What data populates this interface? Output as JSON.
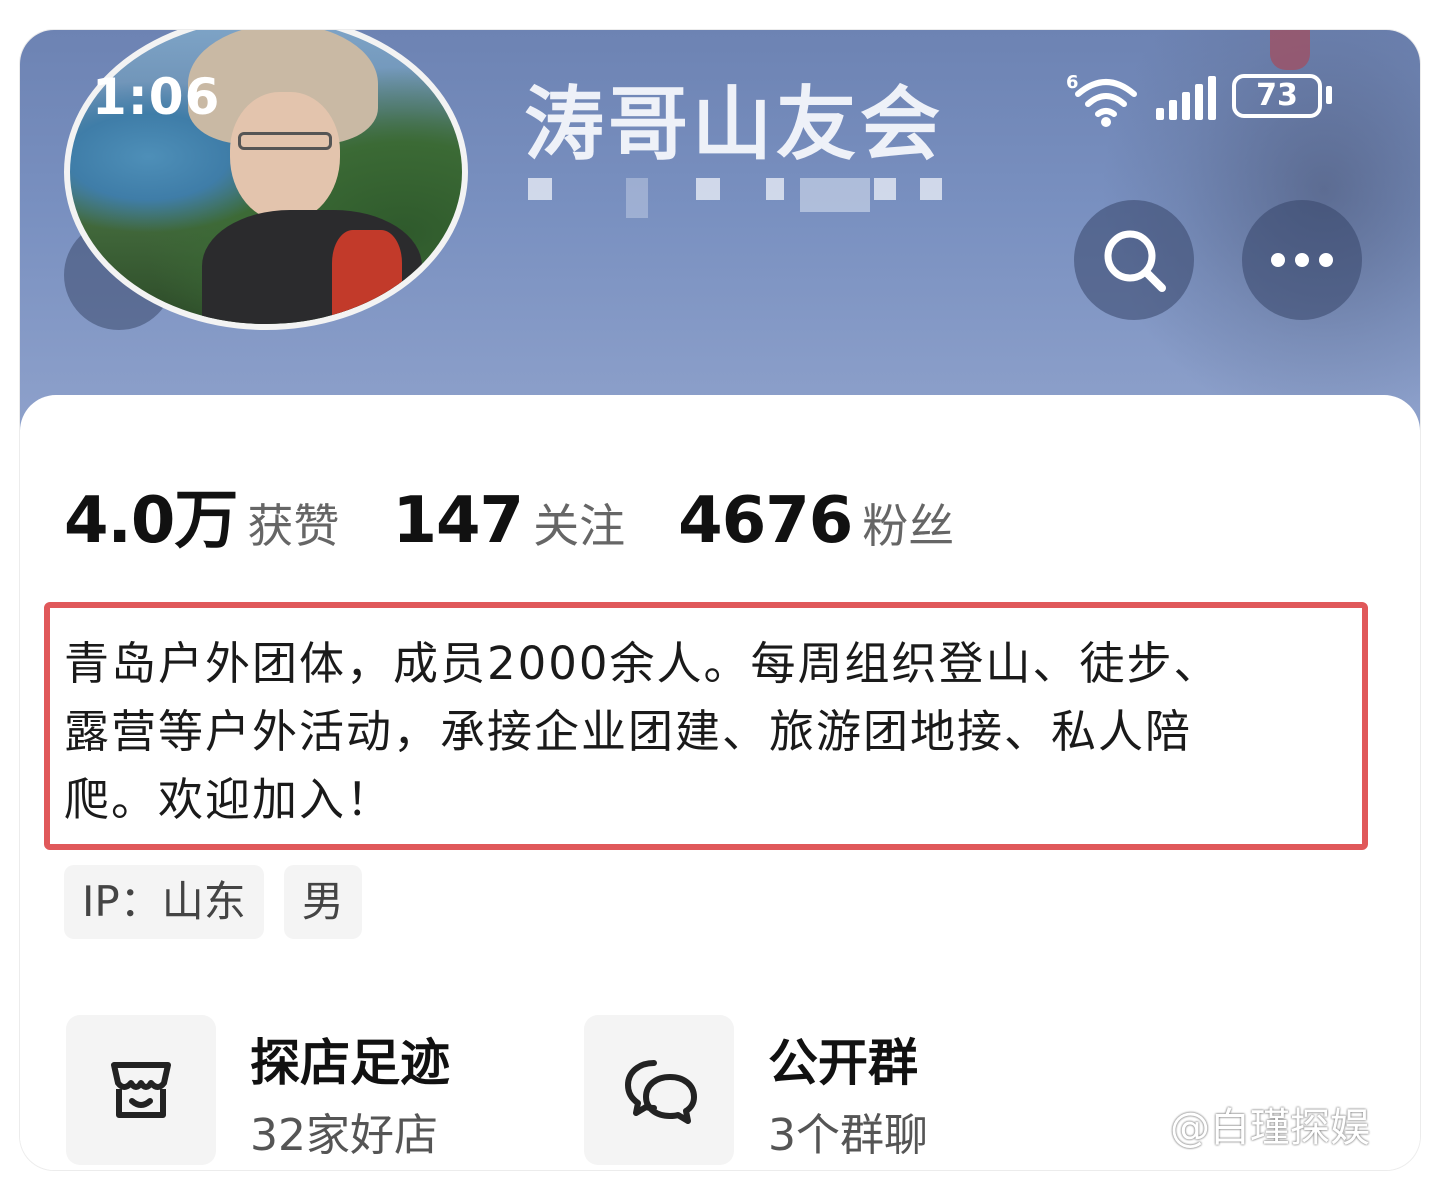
{
  "status_bar": {
    "time": "1:06",
    "network_badge": "6",
    "battery_level": "73"
  },
  "header": {
    "account_name": "涛哥山友会",
    "search_icon": "search-icon",
    "more_icon": "more-dots-icon",
    "back_icon": "chevron-left-icon"
  },
  "stats": [
    {
      "value": "4.0万",
      "label": "获赞"
    },
    {
      "value": "147",
      "label": "关注"
    },
    {
      "value": "4676",
      "label": "粉丝"
    }
  ],
  "bio": {
    "lines": [
      "青岛户外团体，成员2000余人。每周组织登山、徒步、",
      "露营等户外活动，承接企业团建、旅游团地接、私人陪",
      "爬。欢迎加入！"
    ],
    "highlight_color": "#e0585a"
  },
  "tags": [
    {
      "label": "IP：山东"
    },
    {
      "label": "男"
    }
  ],
  "entries": [
    {
      "icon": "shop-icon",
      "title": "探店足迹",
      "subtitle": "32家好店"
    },
    {
      "icon": "chat-bubbles-icon",
      "title": "公开群",
      "subtitle": "3个群聊"
    }
  ],
  "watermark": "@白瑾探娱"
}
